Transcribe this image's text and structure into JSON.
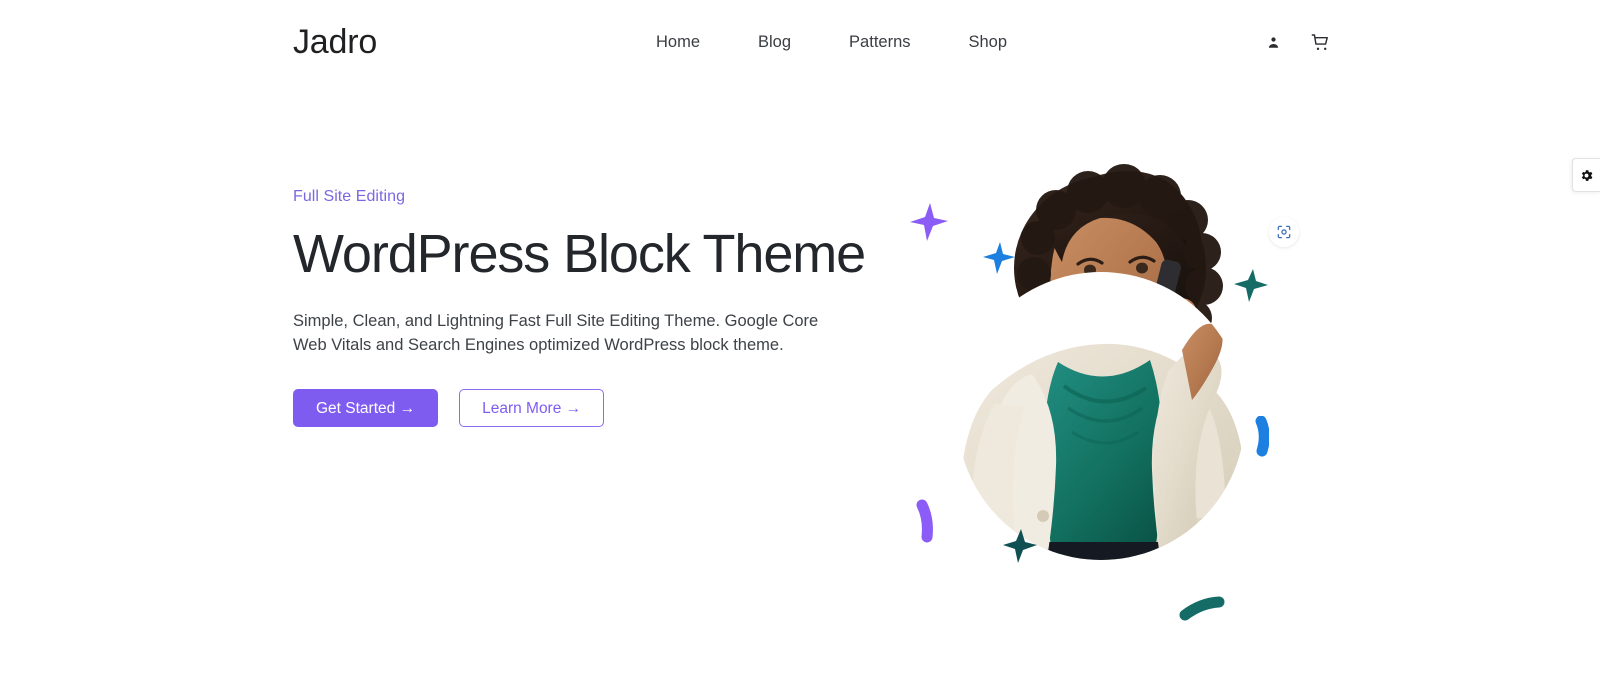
{
  "header": {
    "brand": "Jadro",
    "nav": [
      {
        "label": "Home"
      },
      {
        "label": "Blog"
      },
      {
        "label": "Patterns"
      },
      {
        "label": "Shop"
      }
    ],
    "tools": [
      {
        "name": "account-icon",
        "title": "Account"
      },
      {
        "name": "cart-icon",
        "title": "Cart"
      }
    ]
  },
  "hero": {
    "eyebrow": "Full Site Editing",
    "title": "WordPress Block Theme",
    "description": "Simple, Clean, and Lightning Fast Full Site Editing Theme. Google Core Web Vitals and Search Engines optimized WordPress block theme.",
    "primary_button": "Get Started →",
    "secondary_button": "Learn More →",
    "image_alt": "Smiling woman in teal top and cream blazer talking on a mobile phone",
    "lens_badge": "image-search-icon"
  },
  "side_tab": {
    "icon": "gear-icon",
    "title": "Settings"
  },
  "colors": {
    "accent_purple": "#7f5cf0",
    "eyebrow_purple": "#7a68e3",
    "heading": "#23262a",
    "body_text": "#3e4247",
    "nav_text": "#3a3d42",
    "circle_bg": "#f4f4fb",
    "deco_purple": "#8b5cf6",
    "deco_blue": "#1d7fe0",
    "deco_teal": "#156b66",
    "lens_blue": "#3c6fb5",
    "page_bg": "#ffffff"
  },
  "decorations": [
    {
      "name": "star-purple-top-left",
      "color": "#8b5cf6",
      "shape": "4-point-star"
    },
    {
      "name": "star-blue-upper-left",
      "color": "#1d7fe0",
      "shape": "4-point-star"
    },
    {
      "name": "star-teal-right",
      "color": "#156b66",
      "shape": "4-point-star"
    },
    {
      "name": "star-teal-bottom-left",
      "color": "#104f52",
      "shape": "4-point-star"
    },
    {
      "name": "squiggle-blue-right",
      "color": "#1d7fe0",
      "shape": "curved-stroke"
    },
    {
      "name": "squiggle-purple-left",
      "color": "#8b5cf6",
      "shape": "curved-stroke"
    },
    {
      "name": "squiggle-teal-bottom",
      "color": "#156b66",
      "shape": "curved-stroke"
    }
  ]
}
